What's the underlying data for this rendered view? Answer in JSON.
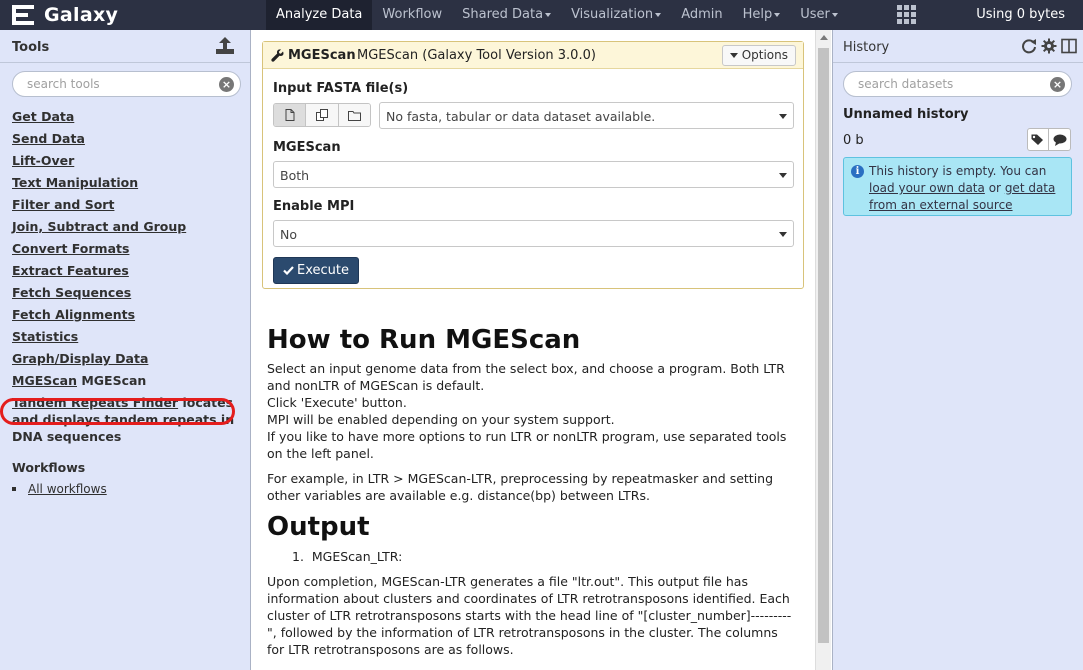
{
  "masthead": {
    "brand": "Galaxy",
    "nav": [
      {
        "label": "Analyze Data",
        "dropdown": false,
        "active": true
      },
      {
        "label": "Workflow",
        "dropdown": false,
        "active": false
      },
      {
        "label": "Shared Data",
        "dropdown": true,
        "active": false
      },
      {
        "label": "Visualization",
        "dropdown": true,
        "active": false
      },
      {
        "label": "Admin",
        "dropdown": false,
        "active": false
      },
      {
        "label": "Help",
        "dropdown": true,
        "active": false
      },
      {
        "label": "User",
        "dropdown": true,
        "active": false
      }
    ],
    "quota": "Using 0 bytes",
    "colors": {
      "background": "#2c3143",
      "active_tab": "#1e2230"
    }
  },
  "tools_panel": {
    "title": "Tools",
    "search_placeholder": "search tools",
    "tools": [
      "Get Data",
      "Send Data",
      "Lift-Over",
      "Text Manipulation",
      "Filter and Sort",
      "Join, Subtract and Group",
      "Convert Formats",
      "Extract Features",
      "Fetch Sequences",
      "Fetch Alignments",
      "Statistics",
      "Graph/Display Data"
    ],
    "mgescan": {
      "link": "MGEScan",
      "desc": "MGEScan"
    },
    "tandem": {
      "link": "Tandem Repeats Finder",
      "desc": "locates and displays tandem repeats in DNA sequences"
    },
    "workflows_title": "Workflows",
    "workflows_link": "All workflows"
  },
  "tool_form": {
    "name": "MGEScan",
    "description": "MGEScan (Galaxy Tool Version 3.0.0)",
    "options_label": "Options",
    "fields": [
      {
        "label": "Input FASTA file(s)",
        "value": "No fasta, tabular or data dataset available."
      },
      {
        "label": "MGEScan",
        "value": "Both"
      },
      {
        "label": "Enable MPI",
        "value": "No"
      }
    ],
    "execute_label": "Execute"
  },
  "help": {
    "heading": "How to Run MGEScan",
    "p1_lines": [
      "Select an input genome data from the select box, and choose a program. Both LTR and nonLTR of MGEScan is default.",
      "Click 'Execute' button.",
      "MPI will be enabled depending on your system support.",
      "If you like to have more options to run LTR or nonLTR program, use separated tools on the left panel."
    ],
    "p2": "For example, in LTR > MGEScan-LTR, preprocessing by repeatmasker and setting other variables are available e.g. distance(bp) between LTRs.",
    "output_heading": "Output",
    "output_item": "MGEScan_LTR:",
    "p3": "Upon completion, MGEScan-LTR generates a file \"ltr.out\". This output file has information about clusters and coordinates of LTR retrotransposons identified. Each cluster of LTR retrotransposons starts with the head line of \"[cluster_number]---------\", followed by the information of LTR retrotransposons in the cluster. The columns for LTR retrotransposons are as follows."
  },
  "history_panel": {
    "title": "History",
    "search_placeholder": "search datasets",
    "name": "Unnamed history",
    "size": "0 b",
    "empty_msg": "This history is empty. You can",
    "link1": "load your own data",
    "or_text": "or",
    "link2": "get data from an external source"
  },
  "icons": [
    "galaxy-logo-icon",
    "apps-grid-icon",
    "upload-icon",
    "clear-search-icon",
    "wrench-icon",
    "refresh-icon",
    "gear-icon",
    "columns-icon",
    "tags-icon",
    "comment-icon",
    "info-icon",
    "check-icon",
    "file-icon",
    "files-icon",
    "folder-icon"
  ],
  "highlight_color": "#e41d1d"
}
